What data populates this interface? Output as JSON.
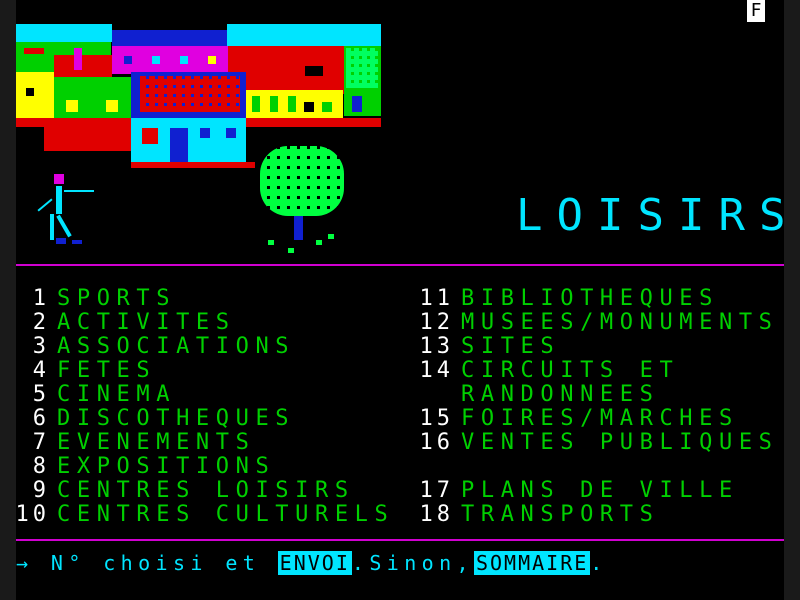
{
  "mode_indicator": "F",
  "page_title": "LOISIRS",
  "menu_left": [
    {
      "num": "1",
      "label": "SPORTS"
    },
    {
      "num": "2",
      "label": "ACTIVITES"
    },
    {
      "num": "3",
      "label": "ASSOCIATIONS"
    },
    {
      "num": "4",
      "label": "FETES"
    },
    {
      "num": "5",
      "label": "CINEMA"
    },
    {
      "num": "6",
      "label": "DISCOTHEQUES"
    },
    {
      "num": "7",
      "label": "EVENEMENTS"
    },
    {
      "num": "8",
      "label": "EXPOSITIONS"
    },
    {
      "num": "9",
      "label": "CENTRES LOISIRS"
    },
    {
      "num": "10",
      "label": "CENTRES CULTURELS"
    }
  ],
  "menu_right": [
    {
      "num": "11",
      "label": "BIBLIOTHEQUES"
    },
    {
      "num": "12",
      "label": "MUSEES/MONUMENTS"
    },
    {
      "num": "13",
      "label": "SITES"
    },
    {
      "num": "14",
      "label": "CIRCUITS ET"
    },
    {
      "num": "",
      "label": "RANDONNEES"
    },
    {
      "num": "15",
      "label": "FOIRES/MARCHES"
    },
    {
      "num": "16",
      "label": "VENTES PUBLIQUES"
    },
    {
      "num": "",
      "label": ""
    },
    {
      "num": "17",
      "label": "PLANS DE VILLE"
    },
    {
      "num": "18",
      "label": "TRANSPORTS"
    }
  ],
  "prompt": {
    "arrow": "→",
    "text_before": "N° choisi et",
    "envoi_label": "ENVOI",
    "text_middle": ".Sinon,",
    "sommaire_label": "SOMMAIRE",
    "text_after": "."
  },
  "colors": {
    "title": "#00e5ff",
    "menu_label": "#00d000",
    "menu_number": "#ffffff",
    "divider": "#d000d0"
  }
}
